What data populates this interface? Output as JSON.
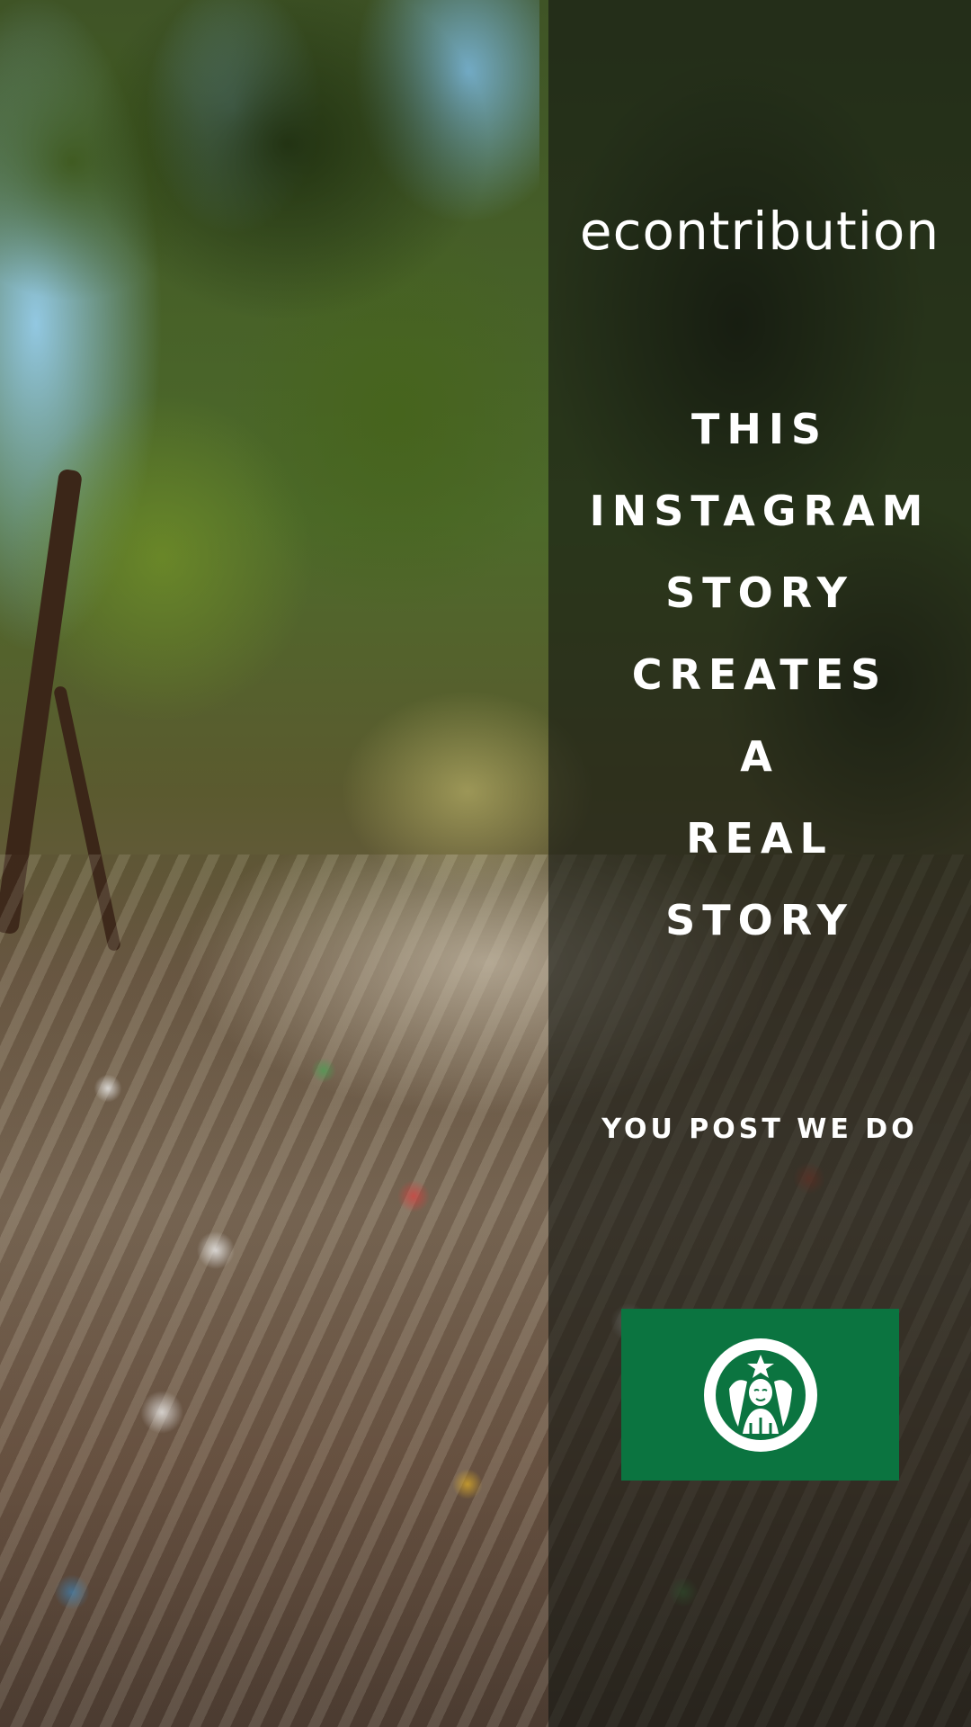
{
  "brand": {
    "name": "econtribution"
  },
  "headline": {
    "lines": [
      "THIS",
      "INSTAGRAM",
      "STORY",
      "CREATES",
      "A",
      "REAL",
      "STORY"
    ]
  },
  "tagline": "YOU POST WE DO",
  "sponsor": {
    "logo_icon": "siren-logo-icon",
    "background_color": "#0b7440"
  },
  "colors": {
    "text": "#ffffff",
    "panel_overlay": "#141612"
  }
}
